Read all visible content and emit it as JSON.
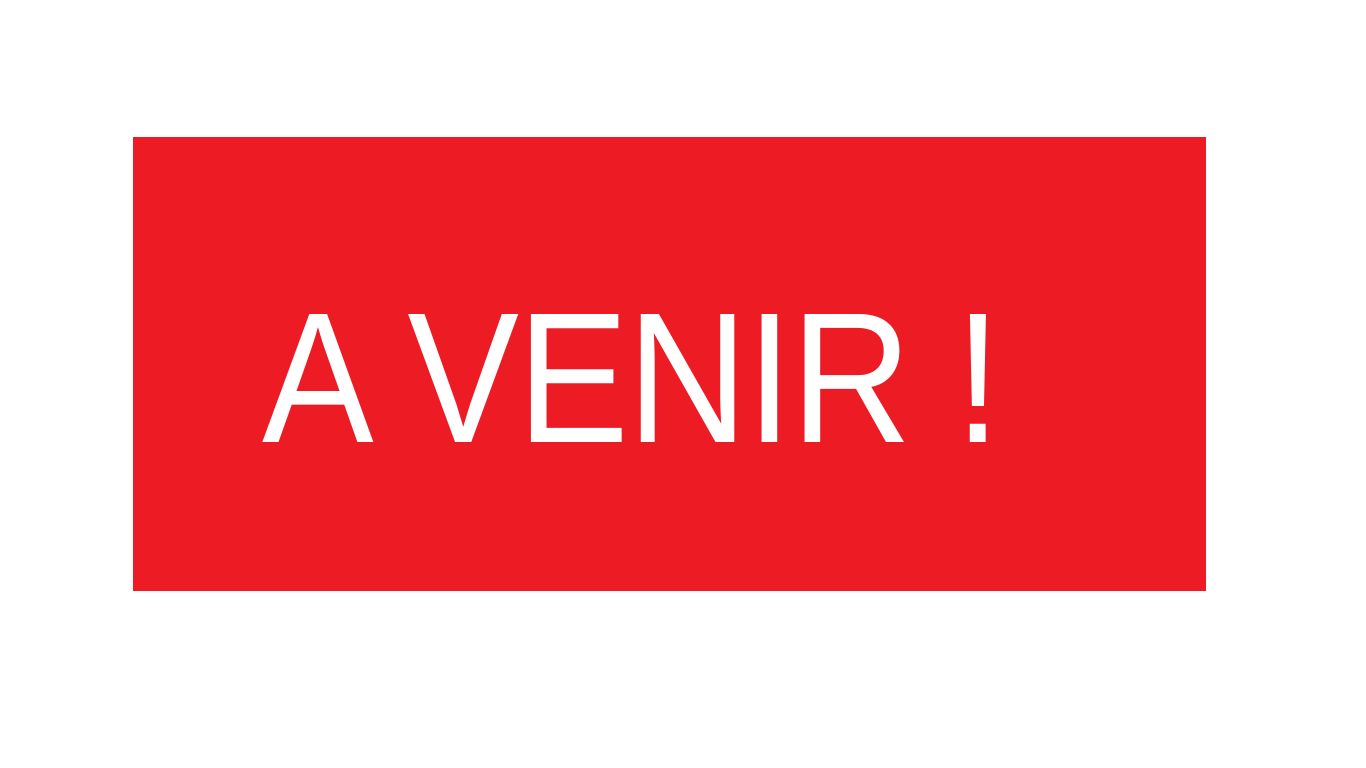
{
  "banner": {
    "text": "A VENIR !",
    "background_color": "#ed1c24",
    "text_color": "#ffffff"
  }
}
